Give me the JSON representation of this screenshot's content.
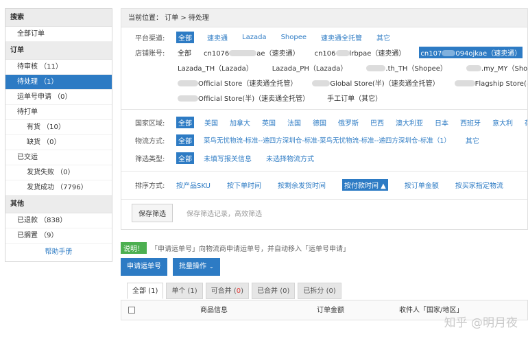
{
  "sidebar": {
    "search_header": "搜索",
    "all_orders": "全部订单",
    "orders_header": "订单",
    "pending_review": "待审核 （11）",
    "pending": "待处理 （1）",
    "waybill_apply": "运单号申请 （0）",
    "to_print": "待打单",
    "in_stock": "有货 （10）",
    "out_of_stock": "缺货 （0）",
    "shipped": "已交运",
    "ship_failed": "发货失败 （0）",
    "ship_success": "发货成功 （7796）",
    "other_header": "其他",
    "refunded": "已退款 （838）",
    "ignored": "已搁置 （9）",
    "help": "帮助手册"
  },
  "breadcrumb": "当前位置： 订单 > 待处理",
  "filters": {
    "platform_label": "平台渠道:",
    "platforms": [
      "全部",
      "速卖通",
      "Lazada",
      "Shopee",
      "速卖通全托管",
      "其它"
    ],
    "store_label": "店铺账号:",
    "stores_row1": {
      "all": "全部",
      "s1_prefix": "cn1076",
      "s1_suffix": "ae（速卖通）",
      "s2_prefix": "cn106",
      "s2_suffix": "lrbpae（速卖通）",
      "s3_prefix": "cn107",
      "s3_suffix": "094ojkae（速卖通）"
    },
    "stores_row2": {
      "s4": "Lazada_TH（Lazada）",
      "s5": "Lazada_PH（Lazada）",
      "s6": ".th_TH（Shopee）",
      "s7": ".my_MY（Shopee）"
    },
    "stores_row3": {
      "s8": "Official Store（速卖通全托管）",
      "s9": "Global Store(半)（速卖通全托管）",
      "s10": "Flagship Store(半)"
    },
    "stores_row4": {
      "s11": "Official Store(半)（速卖通全托管）",
      "s12": "手工订单（其它）"
    },
    "region_label": "国家区域:",
    "regions": [
      "全部",
      "美国",
      "加拿大",
      "英国",
      "法国",
      "德国",
      "俄罗斯",
      "巴西",
      "澳大利亚",
      "日本",
      "西班牙",
      "意大利",
      "荷兰"
    ],
    "logistics_label": "物流方式:",
    "logistics": [
      "全部",
      "菜鸟无忧物流-标准--递四方深圳仓-标准-菜鸟无忧物流-标准--递四方深圳仓-标准（1）",
      "其它"
    ],
    "filter_type_label": "筛选类型:",
    "filter_types": [
      "全部",
      "未填写报关信息",
      "未选择物流方式"
    ]
  },
  "sort": {
    "label": "排序方式:",
    "options": [
      "按产品SKU",
      "按下单时间",
      "按剩余发货时间",
      "按付款时间 ▲",
      "按订单金额",
      "按买家指定物流"
    ]
  },
  "save_filter": {
    "button": "保存筛选",
    "hint": "保存筛选记录，高效筛选"
  },
  "note": {
    "tag": "说明！",
    "text": "「申请运单号」向物流商申请运单号，并自动移入「运单号申请」"
  },
  "actions": {
    "apply_waybill": "申请运单号",
    "batch": "批量操作",
    "caret": "⌄"
  },
  "tabs": {
    "all": "全部 (1)",
    "single": "单个 (1)",
    "mergeable_label": "可合并 (",
    "mergeable_count": "0",
    "mergeable_close": ")",
    "merged": "已合并 (0)",
    "split": "已拆分 (0)"
  },
  "table": {
    "col_product": "商品信息",
    "col_amount": "订单金额",
    "col_recipient": "收件人「国家/地区」"
  },
  "watermark": "知乎 @明月夜",
  "colors": {
    "accent": "#2d7bc4",
    "note_green": "#4caf50",
    "alert_red": "#e53935"
  }
}
